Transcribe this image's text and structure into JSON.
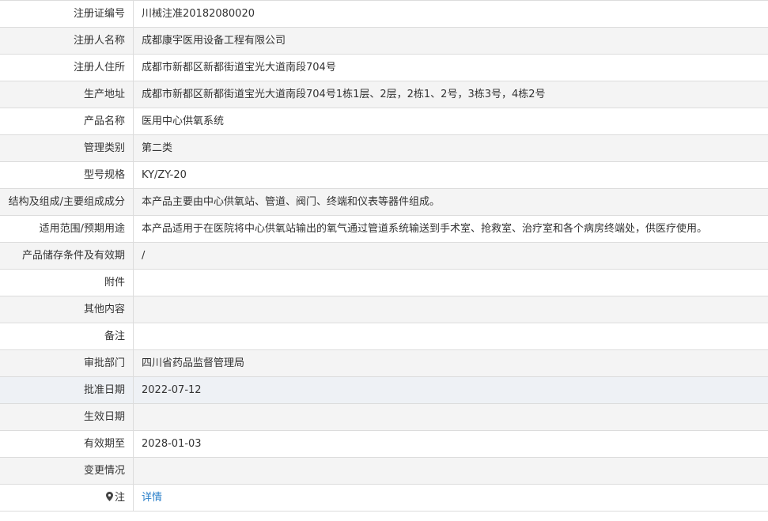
{
  "rows": [
    {
      "label": "注册证编号",
      "value": "川械注准20182080020"
    },
    {
      "label": "注册人名称",
      "value": "成都康宇医用设备工程有限公司"
    },
    {
      "label": "注册人住所",
      "value": "成都市新都区新都街道宝光大道南段704号"
    },
    {
      "label": "生产地址",
      "value": "成都市新都区新都街道宝光大道南段704号1栋1层、2层，2栋1、2号，3栋3号，4栋2号"
    },
    {
      "label": "产品名称",
      "value": "医用中心供氧系统"
    },
    {
      "label": "管理类别",
      "value": "第二类"
    },
    {
      "label": "型号规格",
      "value": "KY/ZY-20"
    },
    {
      "label": "结构及组成/主要组成成分",
      "value": "本产品主要由中心供氧站、管道、阀门、终端和仪表等器件组成。"
    },
    {
      "label": "适用范围/预期用途",
      "value": "本产品适用于在医院将中心供氧站输出的氧气通过管道系统输送到手术室、抢救室、治疗室和各个病房终端处，供医疗使用。"
    },
    {
      "label": "产品储存条件及有效期",
      "value": "/"
    },
    {
      "label": "附件",
      "value": ""
    },
    {
      "label": "其他内容",
      "value": ""
    },
    {
      "label": "备注",
      "value": ""
    },
    {
      "label": "审批部门",
      "value": "四川省药品监督管理局"
    },
    {
      "label": "批准日期",
      "value": "2022-07-12"
    },
    {
      "label": "生效日期",
      "value": ""
    },
    {
      "label": "有效期至",
      "value": "2028-01-03"
    },
    {
      "label": "变更情况",
      "value": ""
    }
  ],
  "note": {
    "label": "注",
    "icon": "location-pin-icon",
    "link_text": "详情",
    "link_color": "#2a7fc9"
  }
}
